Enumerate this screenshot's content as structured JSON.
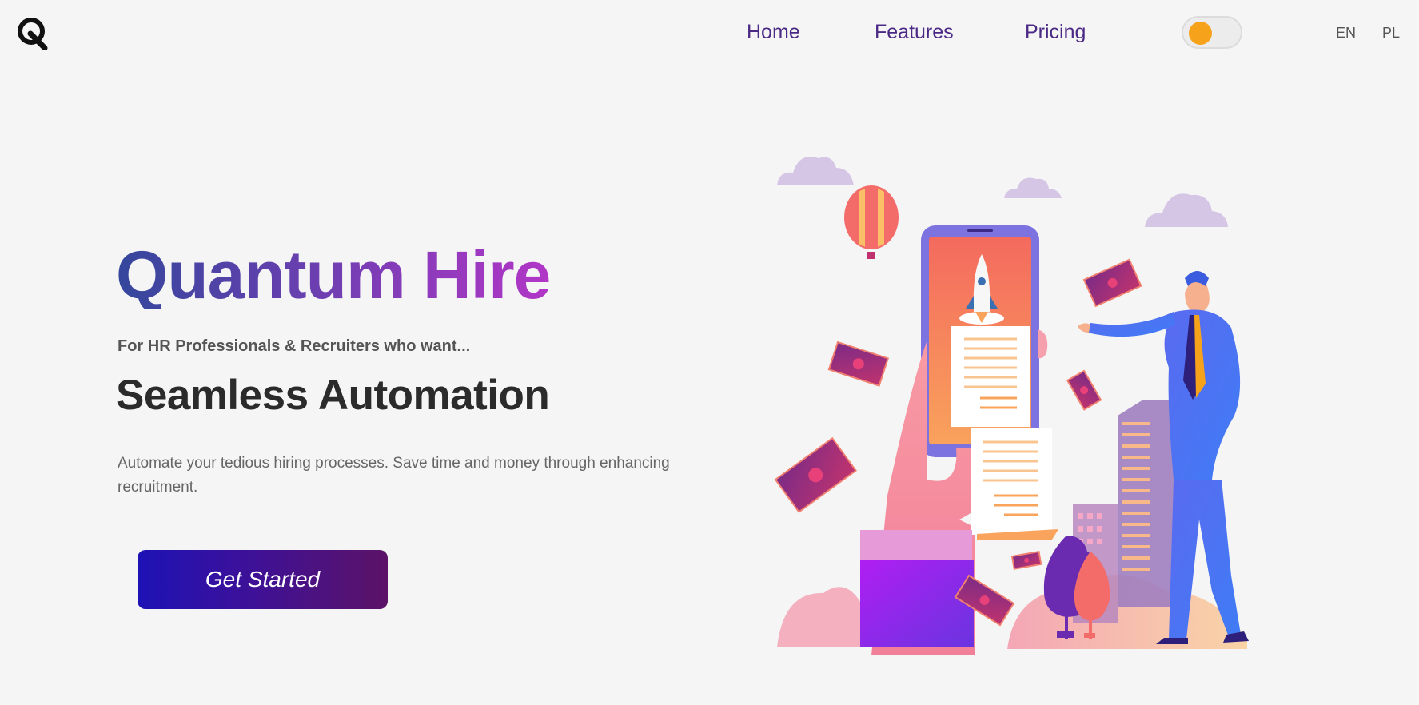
{
  "nav": {
    "home": "Home",
    "features": "Features",
    "pricing": "Pricing",
    "lang_en": "EN",
    "lang_pl": "PL"
  },
  "hero": {
    "title": "Quantum Hire",
    "subtitle": "For HR Professionals & Recruiters who want...",
    "headline": "Seamless Automation",
    "description": "Automate your tedious hiring processes. Save time and money through enhancing recruitment.",
    "cta_label": "Get Started"
  },
  "theme": {
    "background": "#f5f5f5",
    "accent": "#4b2a86",
    "toggle_knob": "#f7a21b",
    "cta_gradient": [
      "#1d12b5",
      "#5c1266"
    ],
    "title_gradient": [
      "#34479c",
      "#b236c7"
    ]
  }
}
